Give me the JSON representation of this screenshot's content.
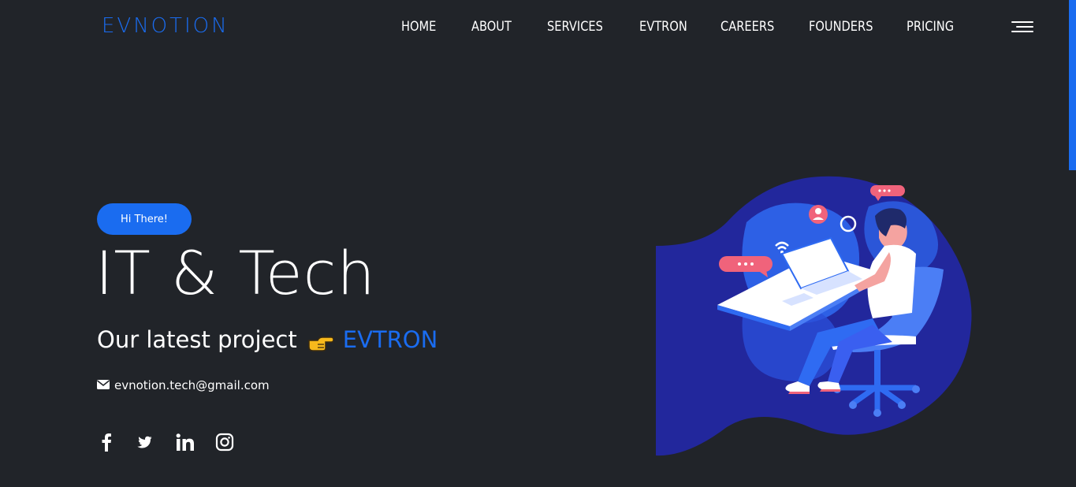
{
  "header": {
    "logo": "EVNOTION",
    "nav": [
      {
        "label": "HOME"
      },
      {
        "label": "ABOUT"
      },
      {
        "label": "SERVICES"
      },
      {
        "label": "EVTRON"
      },
      {
        "label": "CAREERS"
      },
      {
        "label": "FOUNDERS"
      },
      {
        "label": "PRICING"
      }
    ],
    "menu_icon": "hamburger-menu-icon"
  },
  "hero": {
    "greeting": "Hi There!",
    "title": "IT & Tech",
    "project_text": "Our latest project",
    "project_icon": "pointing-right-hand-emoji",
    "project_link": "EVTRON",
    "email": "evnotion.tech@gmail.com",
    "email_icon": "envelope-icon",
    "socials": [
      {
        "icon": "facebook-icon"
      },
      {
        "icon": "twitter-icon"
      },
      {
        "icon": "linkedin-icon"
      },
      {
        "icon": "instagram-icon"
      }
    ]
  },
  "colors": {
    "background": "#212429",
    "accent": "#1a6cf0",
    "text": "#ffffff",
    "illustration_dark": "#22279c",
    "illustration_mid": "#2f6bf2"
  }
}
